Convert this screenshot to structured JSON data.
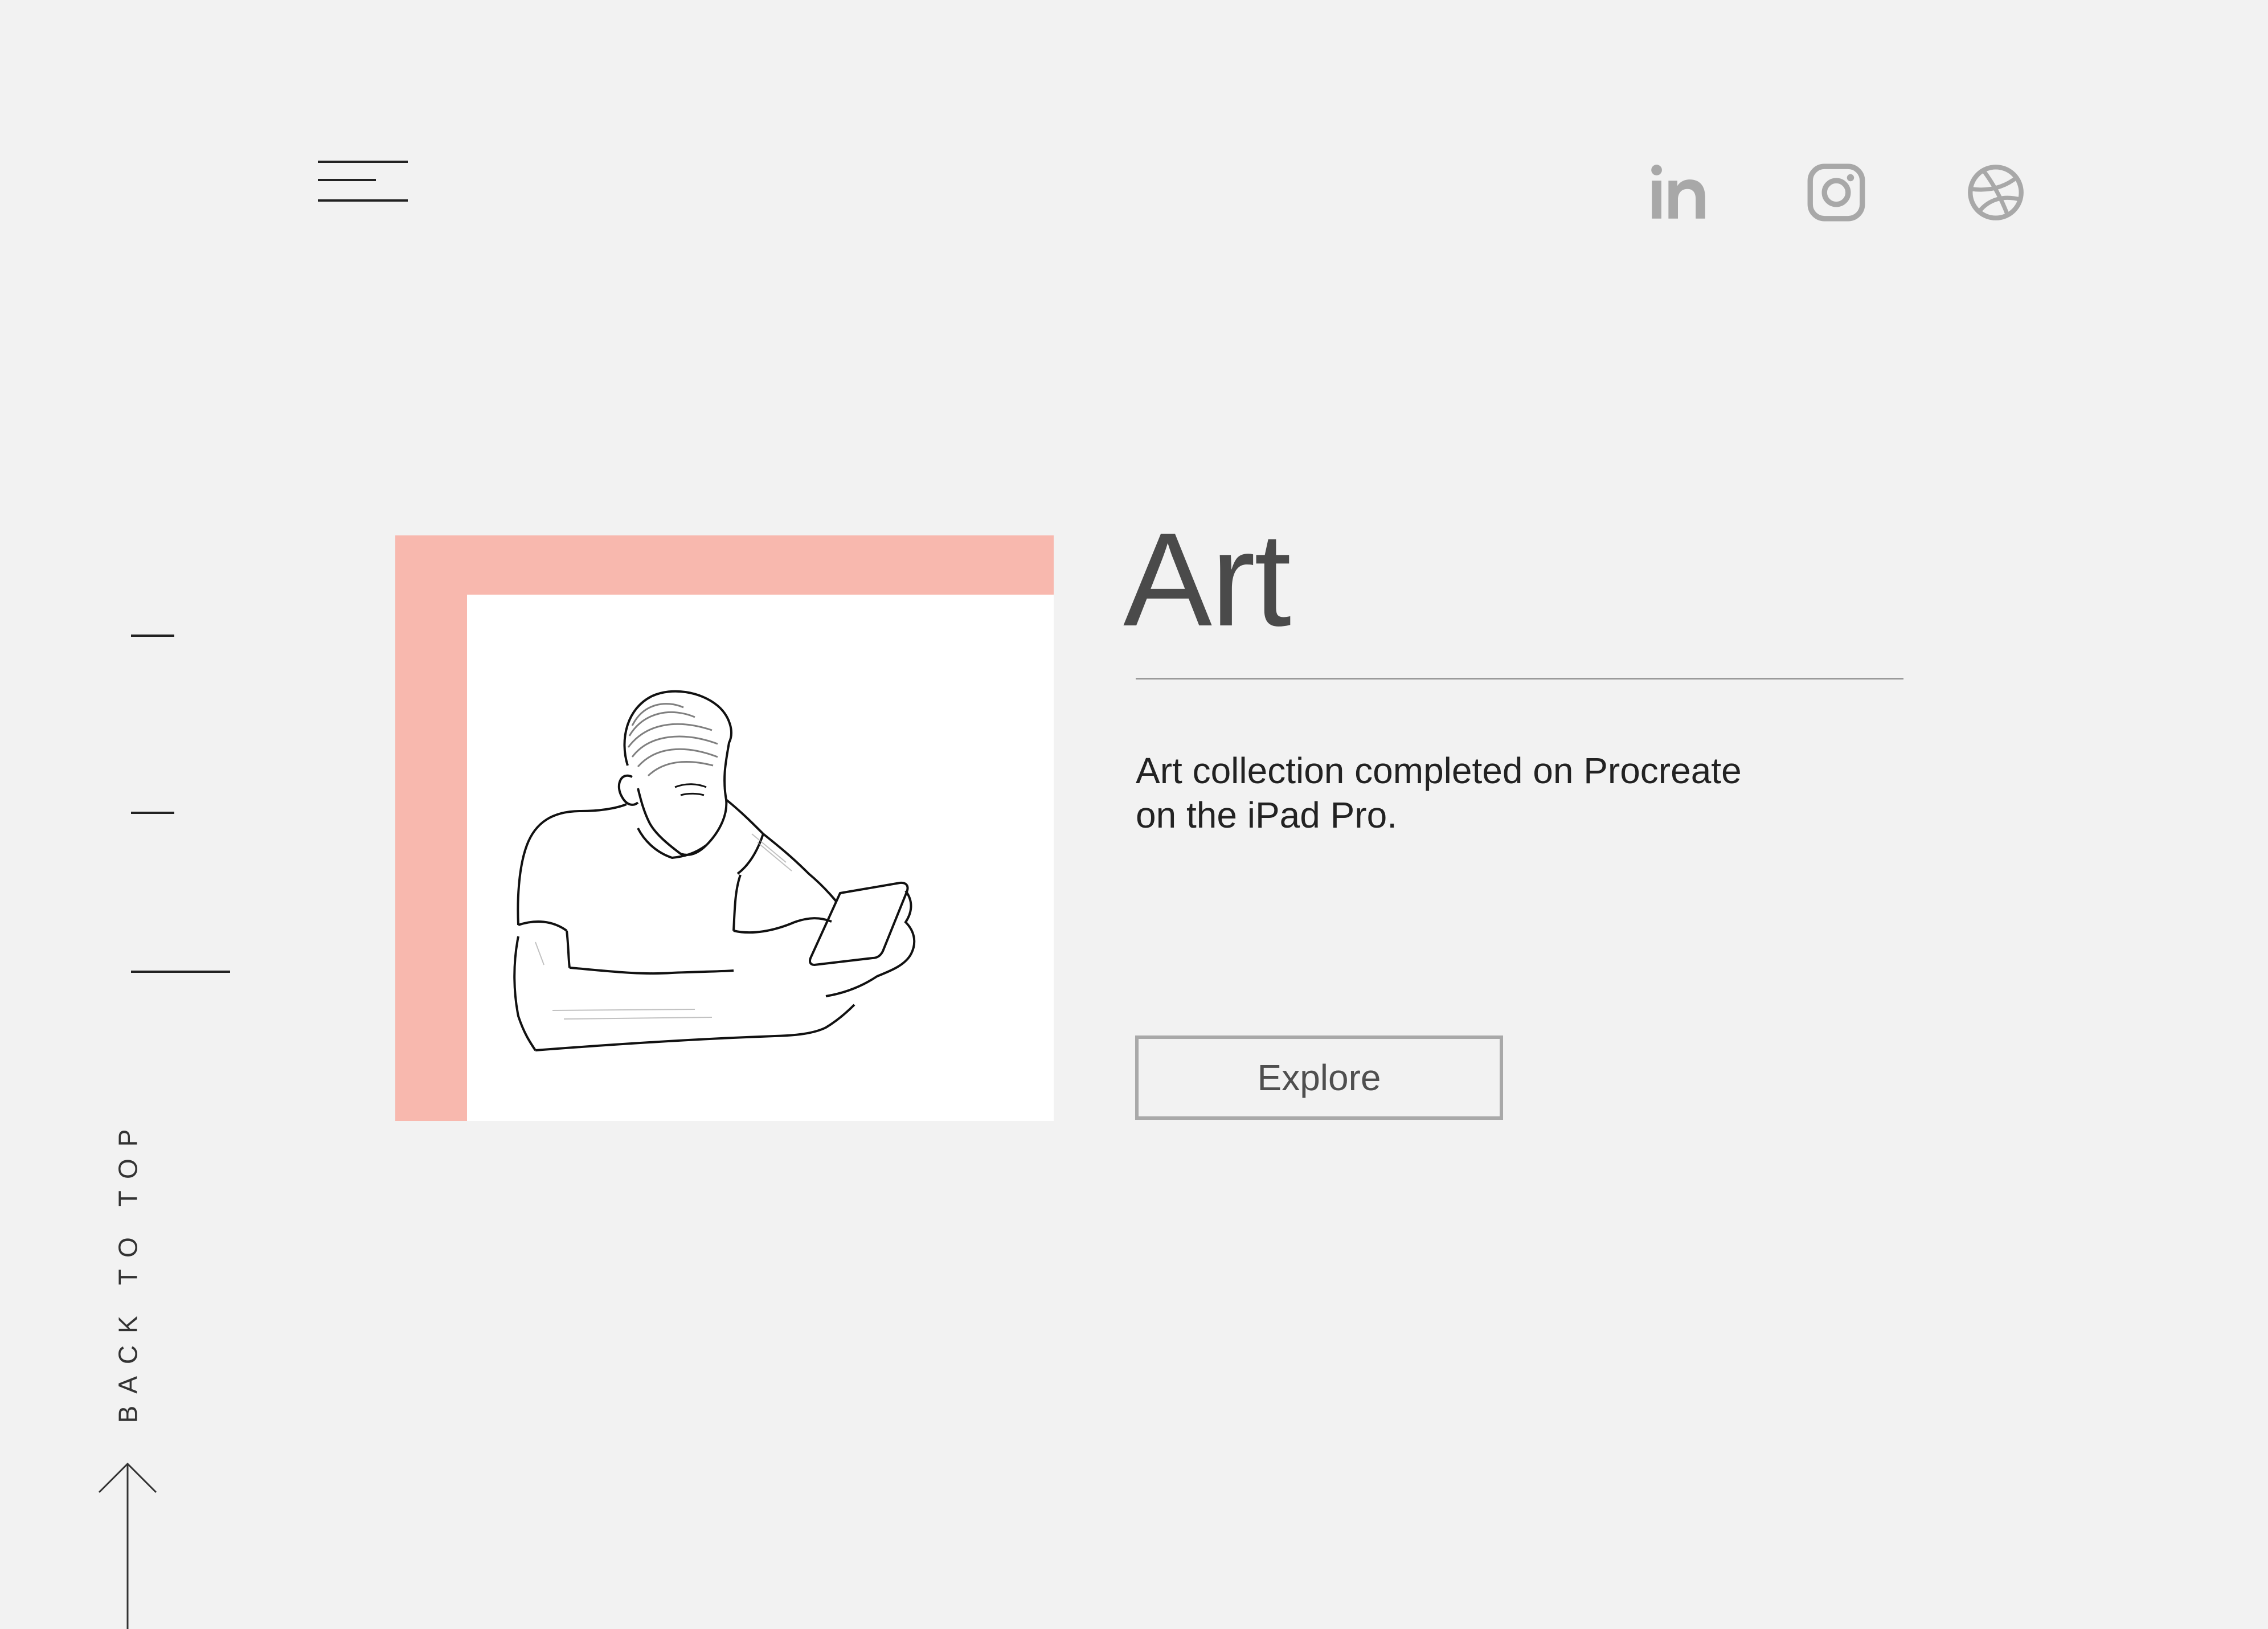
{
  "header": {
    "menu_icon": "hamburger-menu-icon",
    "social_links": [
      {
        "name": "LinkedIn",
        "icon": "linkedin-icon"
      },
      {
        "name": "Instagram",
        "icon": "instagram-icon"
      },
      {
        "name": "Dribbble",
        "icon": "dribbble-icon"
      }
    ]
  },
  "section_indicators": {
    "count": 3,
    "active_index": 2
  },
  "back_to_top": {
    "label": "BACK TO TOP",
    "icon": "arrow-up-icon"
  },
  "artwork": {
    "image": "line-drawing-man-holding-phone",
    "accent_color": "#f8b8ae"
  },
  "main": {
    "title": "Art",
    "description_line1": "Art collection completed on Procreate",
    "description_line2": "on the iPad Pro.",
    "explore_label": "Explore"
  },
  "colors": {
    "background": "#f2f2f2",
    "accent": "#f8b8ae",
    "icon_gray": "#a8a8a8",
    "title_text": "#4a4a4a"
  }
}
